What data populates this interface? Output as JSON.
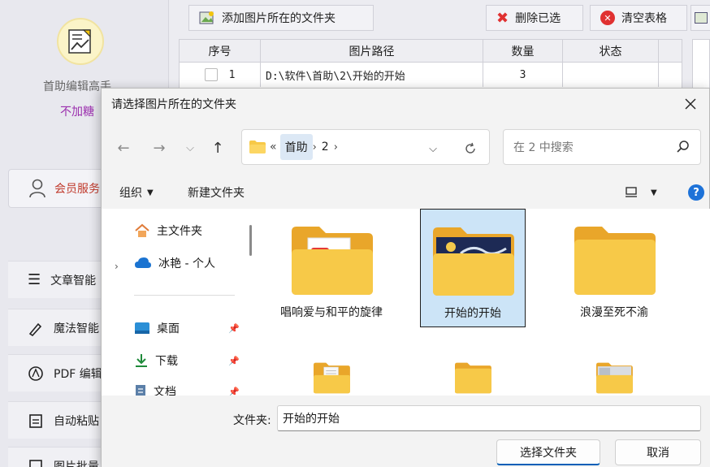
{
  "app": {
    "name": "首助编辑高手",
    "tagline": "不加糖",
    "member_label": "会员服务",
    "menu": [
      {
        "label": "文章智能",
        "icon": "list-icon"
      },
      {
        "label": "魔法智能",
        "icon": "magic-wand-icon"
      },
      {
        "label": "PDF 编辑",
        "icon": "pdf-icon"
      },
      {
        "label": "自动粘贴",
        "icon": "clipboard-icon"
      },
      {
        "label": "图片批量",
        "icon": "image-icon"
      }
    ],
    "toolbar": {
      "add_folder": "添加图片所在的文件夹",
      "delete_selected": "删除已选",
      "clear_table": "清空表格"
    },
    "table": {
      "headers": [
        "序号",
        "图片路径",
        "数量",
        "状态"
      ],
      "rows": [
        {
          "index": "1",
          "path": "D:\\软件\\首助\\2\\开始的开始",
          "count": "3",
          "status": ""
        }
      ]
    }
  },
  "dialog": {
    "title": "请选择图片所在的文件夹",
    "breadcrumb": [
      "«",
      "首助",
      "2"
    ],
    "search_placeholder": "在 2 中搜索",
    "organize": "组织",
    "new_folder": "新建文件夹",
    "nav": [
      {
        "label": "主文件夹",
        "icon": "home-icon"
      },
      {
        "label": "冰艳 - 个人",
        "icon": "cloud-icon"
      },
      {
        "label": "桌面",
        "icon": "desktop-icon"
      },
      {
        "label": "下载",
        "icon": "download-icon"
      },
      {
        "label": "文档",
        "icon": "document-icon"
      }
    ],
    "files": [
      {
        "name": "唱响爱与和平的旋律",
        "thumb": "red-app"
      },
      {
        "name": "开始的开始",
        "thumb": "photo",
        "selected": true
      },
      {
        "name": "浪漫至死不渝",
        "thumb": "empty"
      },
      {
        "name": "",
        "thumb": "doc"
      },
      {
        "name": "",
        "thumb": "empty"
      },
      {
        "name": "",
        "thumb": "photo2"
      }
    ],
    "folder_label": "文件夹:",
    "folder_value": "开始的开始",
    "select_button": "选择文件夹",
    "cancel_button": "取消"
  },
  "colors": {
    "accent": "#005fb8",
    "folder": "#f7c948",
    "folder_dark": "#e9a62a",
    "tag": "#9b2fae",
    "member": "#c0392b"
  }
}
